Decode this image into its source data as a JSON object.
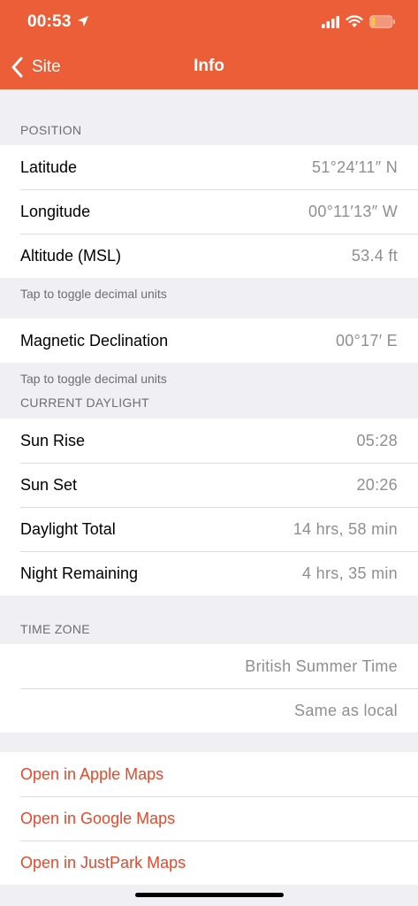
{
  "status_bar": {
    "time": "00:53",
    "location_icon": "location-arrow-icon",
    "signal_icon": "cellular-signal-icon",
    "wifi_icon": "wifi-icon",
    "battery_icon": "battery-low-icon"
  },
  "nav": {
    "back_label": "Site",
    "title": "Info"
  },
  "position": {
    "header": "POSITION",
    "rows": [
      {
        "label": "Latitude",
        "value": "51°24′11″  N"
      },
      {
        "label": "Longitude",
        "value": "00°11′13″  W"
      },
      {
        "label": "Altitude (MSL)",
        "value": "53.4  ft"
      }
    ],
    "footer": "Tap to toggle decimal units"
  },
  "magnetic": {
    "rows": [
      {
        "label": "Magnetic Declination",
        "value": "00°17′  E"
      }
    ],
    "footer": "Tap to toggle decimal units"
  },
  "daylight": {
    "header": "CURRENT DAYLIGHT",
    "rows": [
      {
        "label": "Sun Rise",
        "value": "05:28"
      },
      {
        "label": "Sun Set",
        "value": "20:26"
      },
      {
        "label": "Daylight Total",
        "value": "14 hrs, 58 min"
      },
      {
        "label": "Night Remaining",
        "value": "4 hrs, 35 min"
      }
    ]
  },
  "time_zone": {
    "header": "TIME ZONE",
    "rows": [
      {
        "label": "",
        "value": "British Summer Time"
      },
      {
        "label": "",
        "value": "Same as local"
      }
    ]
  },
  "links": [
    {
      "label": "Open in Apple Maps"
    },
    {
      "label": "Open in Google Maps"
    },
    {
      "label": "Open in JustPark Maps"
    }
  ],
  "colors": {
    "accent": "#ec5e37",
    "link": "#e8472a",
    "background": "#efeff4",
    "secondary_text": "#8e8e93"
  }
}
